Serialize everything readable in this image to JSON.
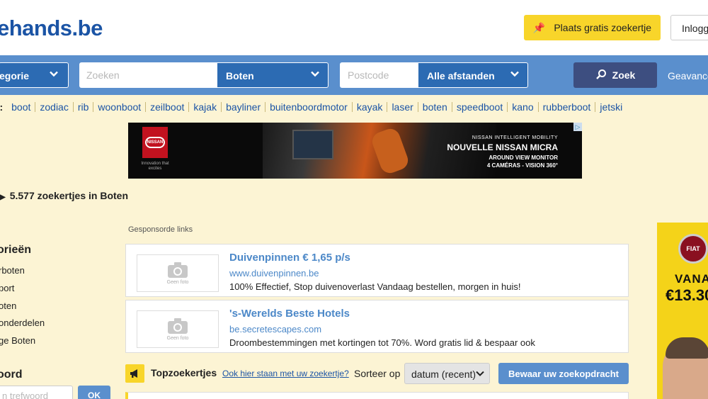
{
  "header": {
    "logo": "ehands.be",
    "place_ad_label": "Plaats gratis zoekertje",
    "login_label": "Inlogg"
  },
  "search": {
    "category_label": "egorie",
    "query_placeholder": "Zoeken",
    "subcategory_label": "Boten",
    "postcode_placeholder": "Postcode",
    "distance_label": "Alle afstanden",
    "search_button": "Zoek",
    "advanced_link": "Geavance"
  },
  "popular": {
    "lead": "r:",
    "keywords": [
      "boot",
      "zodiac",
      "rib",
      "woonboot",
      "zeilboot",
      "kajak",
      "bayliner",
      "buitenboordmotor",
      "kayak",
      "laser",
      "boten",
      "speedboot",
      "kano",
      "rubberboot",
      "jetski"
    ]
  },
  "banner": {
    "brand": "NISSAN",
    "brand_sub": "Innovation that excites",
    "line1": "NISSAN INTELLIGENT MOBILITY",
    "line2": "NOUVELLE NISSAN MICRA",
    "line3": "AROUND VIEW MONITOR",
    "line4": "4 CAMÉRAS - VISION 360°"
  },
  "breadcrumb": "5.577 zoekertjes in Boten",
  "sidebar": {
    "heading": "orieën",
    "items": [
      "rboten",
      "port",
      "oten",
      "onderdelen",
      "ge Boten"
    ],
    "keyword_heading": "oord",
    "keyword_placeholder": "n trefwoord",
    "ok_label": "OK"
  },
  "sponsored_label": "Gesponsorde links",
  "listings": [
    {
      "title": "Duivenpinnen € 1,65 p/s",
      "url": "www.duivenpinnen.be",
      "desc": "100% Effectief, Stop duivenoverlast Vandaag bestellen, morgen in huis!",
      "thumb": "Geen foto"
    },
    {
      "title": "'s-Werelds Beste Hotels",
      "url": "be.secretescapes.com",
      "desc": "Droombestemmingen met kortingen tot 70%. Word gratis lid & bespaar ook",
      "thumb": "Geen foto"
    }
  ],
  "topads": {
    "title": "Topzoekertjes",
    "link": "Ook hier staan met uw zoekertje?",
    "sort_label": "Sorteer op",
    "sort_value": "datum (recent)",
    "save_search": "Bewaar uw zoekopdracht"
  },
  "sky_ad": {
    "brand": "FIAT",
    "word1": "VANA",
    "word2": "€13.30"
  },
  "colors": {
    "brand_blue": "#1b54a5",
    "search_bar": "#5a8fcd",
    "select_blue": "#2c6bb3",
    "search_button": "#3d4e80",
    "accent_yellow": "#f8d52a",
    "page_bg": "#fcf4d4"
  },
  "icons": {
    "place_ad": "pushpin-icon",
    "search": "search-icon",
    "chevron": "chevron-down-icon",
    "no_photo": "camera-icon",
    "top_ads": "megaphone-icon"
  }
}
